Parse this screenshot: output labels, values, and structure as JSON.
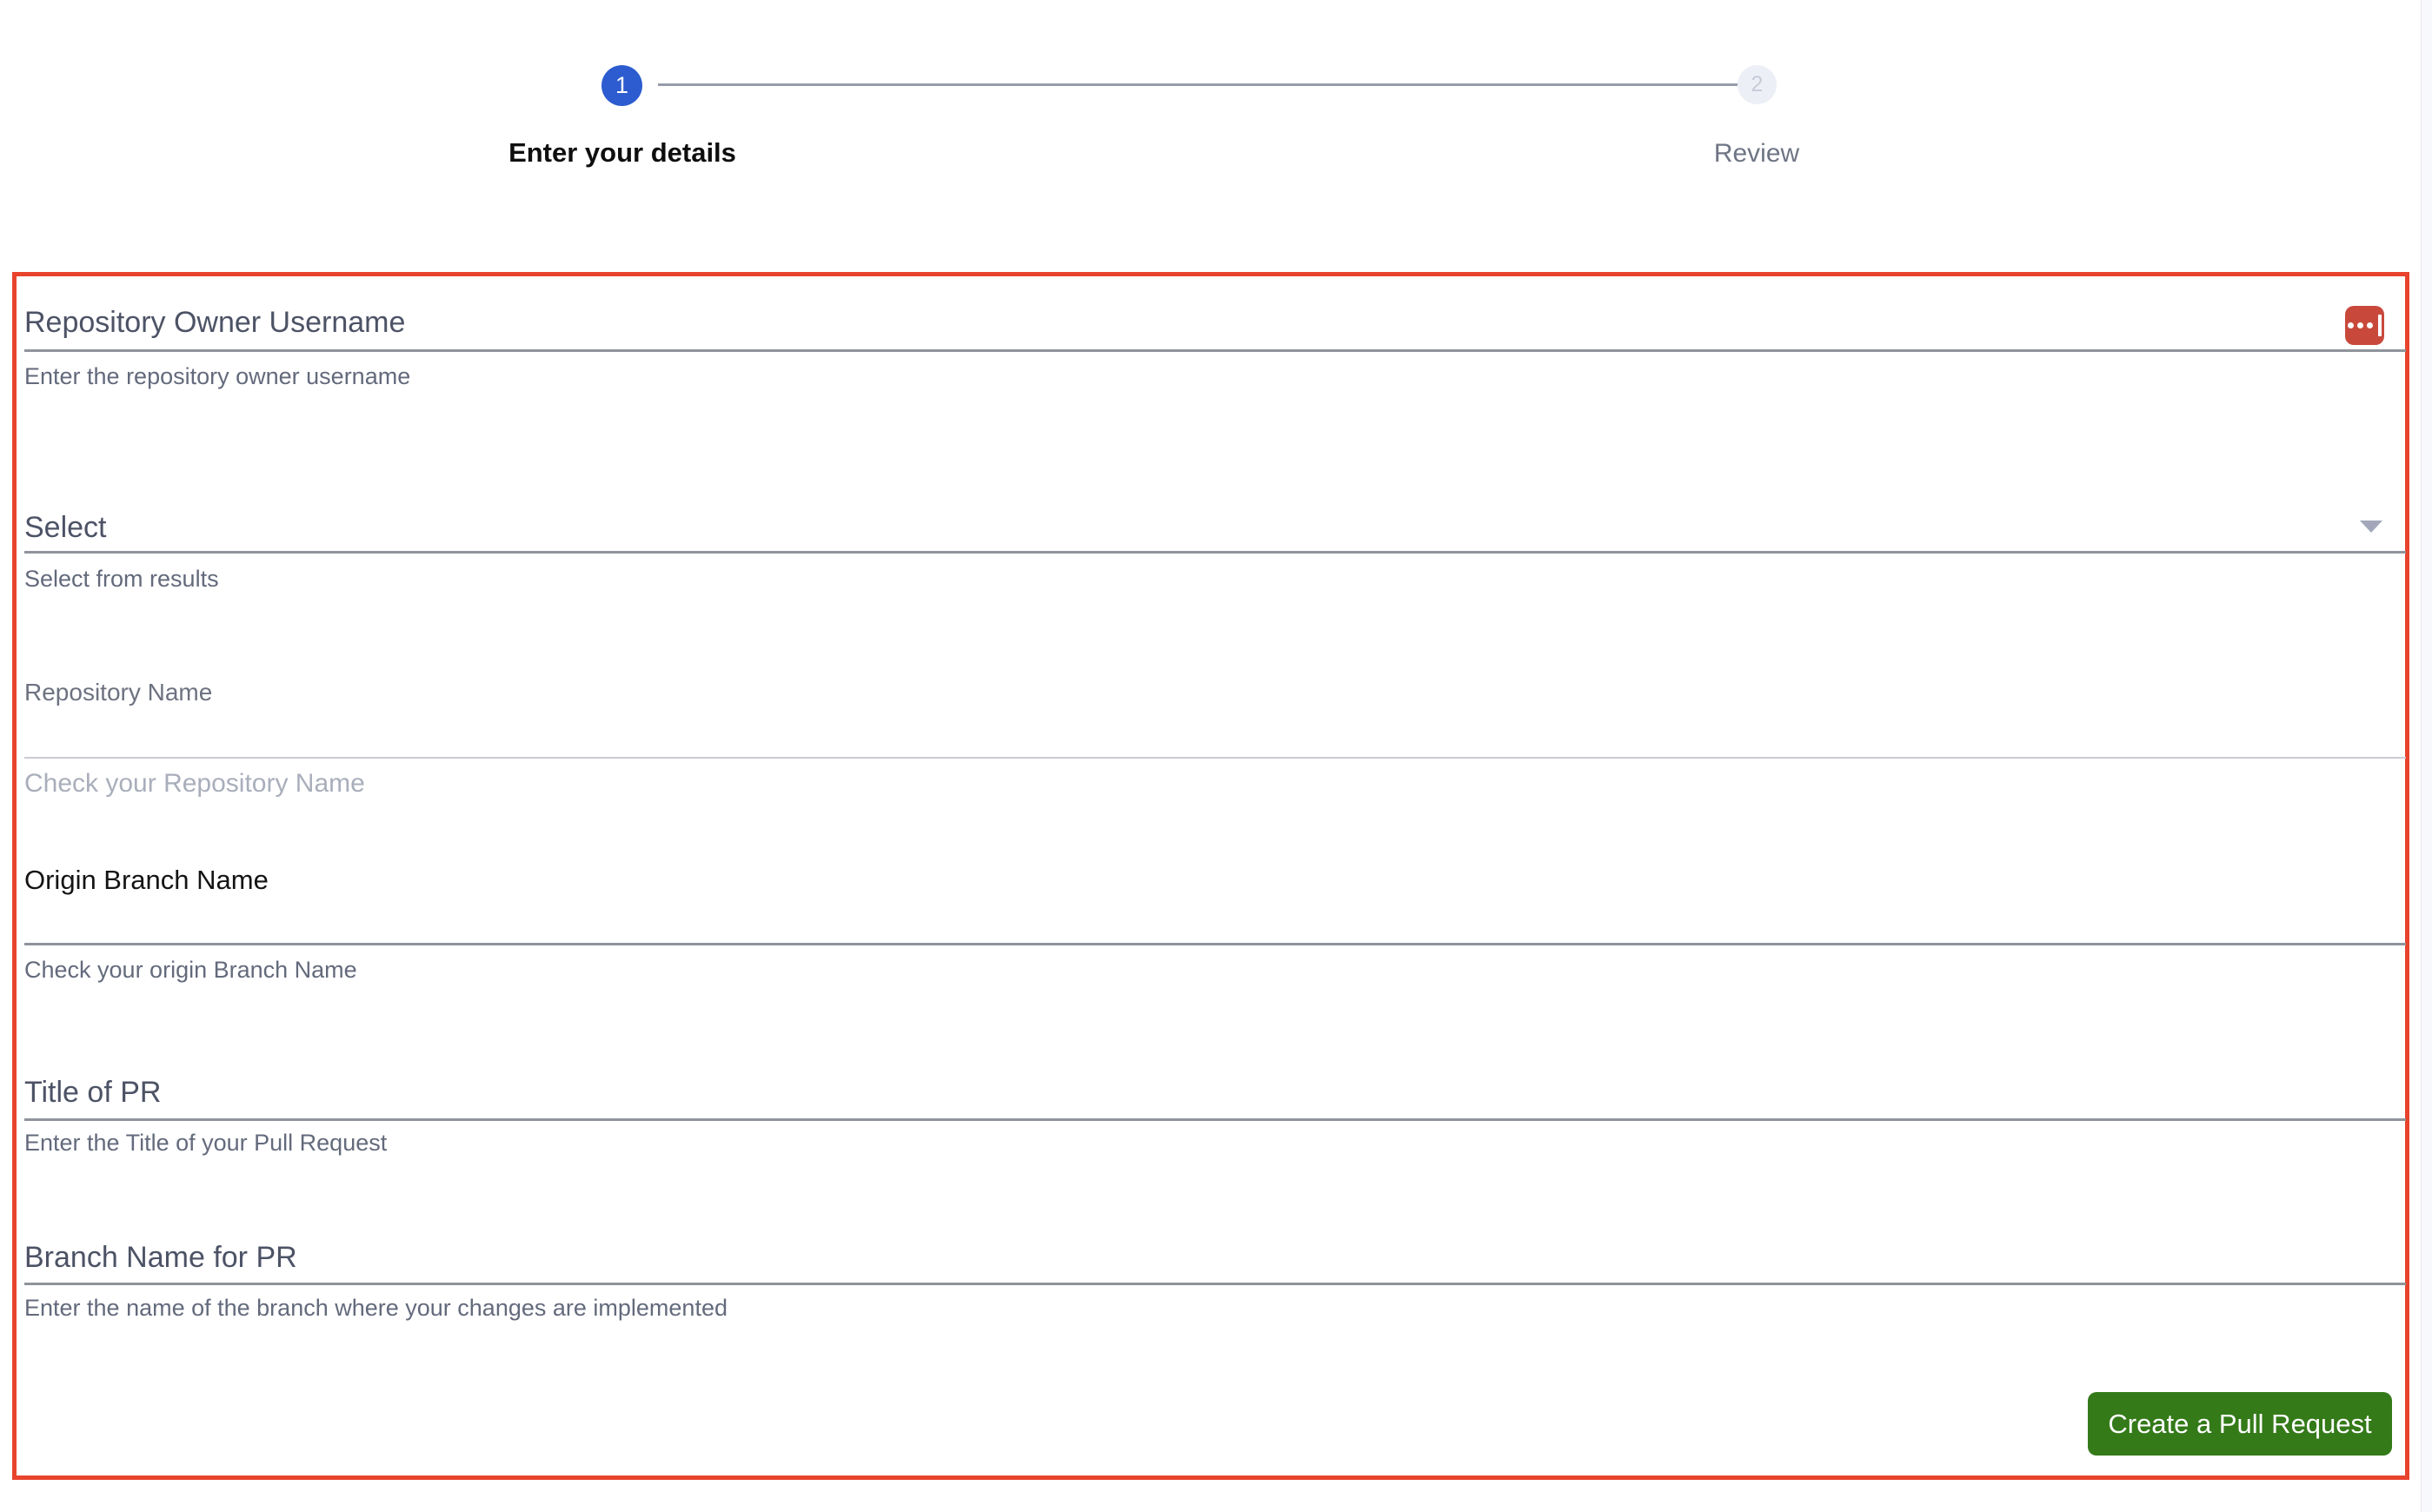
{
  "stepper": {
    "steps": [
      {
        "number": "1",
        "label": "Enter your details",
        "state": "active"
      },
      {
        "number": "2",
        "label": "Review",
        "state": "inactive"
      }
    ]
  },
  "form": {
    "fields": {
      "owner": {
        "label": "Repository Owner Username",
        "helper": "Enter the repository owner username"
      },
      "select": {
        "label": "Select",
        "helper": "Select from results"
      },
      "repository_name": {
        "label": "Repository Name",
        "helper": "Check your Repository Name"
      },
      "origin_branch": {
        "label": "Origin Branch Name",
        "helper": "Check your origin Branch Name"
      },
      "pr_title": {
        "label": "Title of PR",
        "helper": "Enter the Title of your Pull Request"
      },
      "pr_branch": {
        "label": "Branch Name for PR",
        "helper": "Enter the name of the branch where your changes are implemented"
      }
    },
    "submit_button": "Create a Pull Request"
  },
  "icons": {
    "lastpass": "lastpass-vault-icon",
    "select_arrow": "chevron-down-icon"
  },
  "colors": {
    "step_active_blue": "#2c5ccf",
    "step_inactive_gray": "#edeff7",
    "highlight_border_red": "#e8432c",
    "lastpass_red": "#c8493c",
    "submit_green": "#347a19"
  }
}
